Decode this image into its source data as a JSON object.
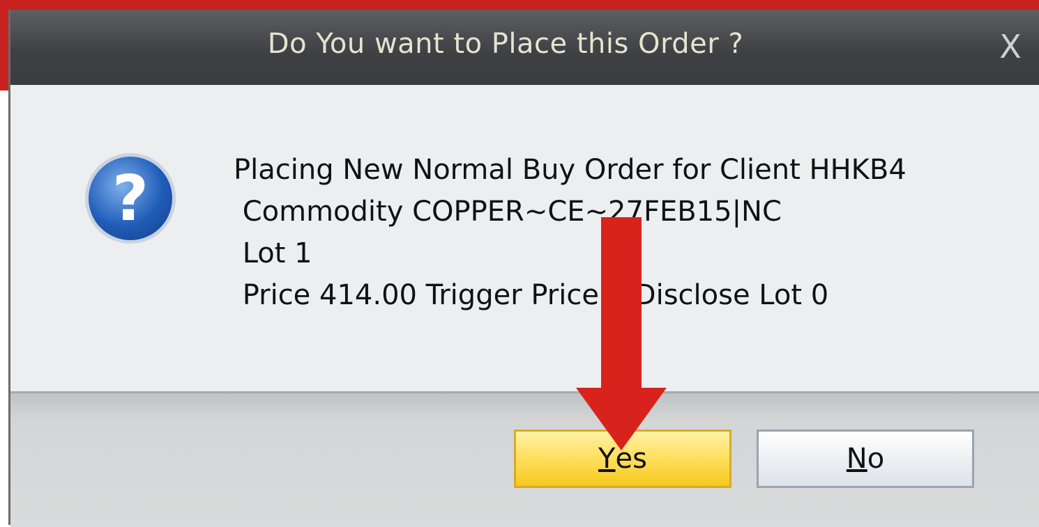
{
  "dialog": {
    "title": "Do You want to Place this Order ?",
    "close_label": "X",
    "icon": "question-icon",
    "message_lines": [
      "Placing New Normal Buy Order for Client HHKB4",
      " Commodity COPPER~CE~27FEB15|NC",
      " Lot 1",
      " Price 414.00 Trigger Price 0 Disclose Lot 0"
    ],
    "buttons": {
      "yes_mnemonic": "Y",
      "yes_rest": "es",
      "no_mnemonic": "N",
      "no_rest": "o"
    }
  },
  "annotation": {
    "arrow_color": "#d8231d",
    "frame_color": "#c8221e"
  }
}
